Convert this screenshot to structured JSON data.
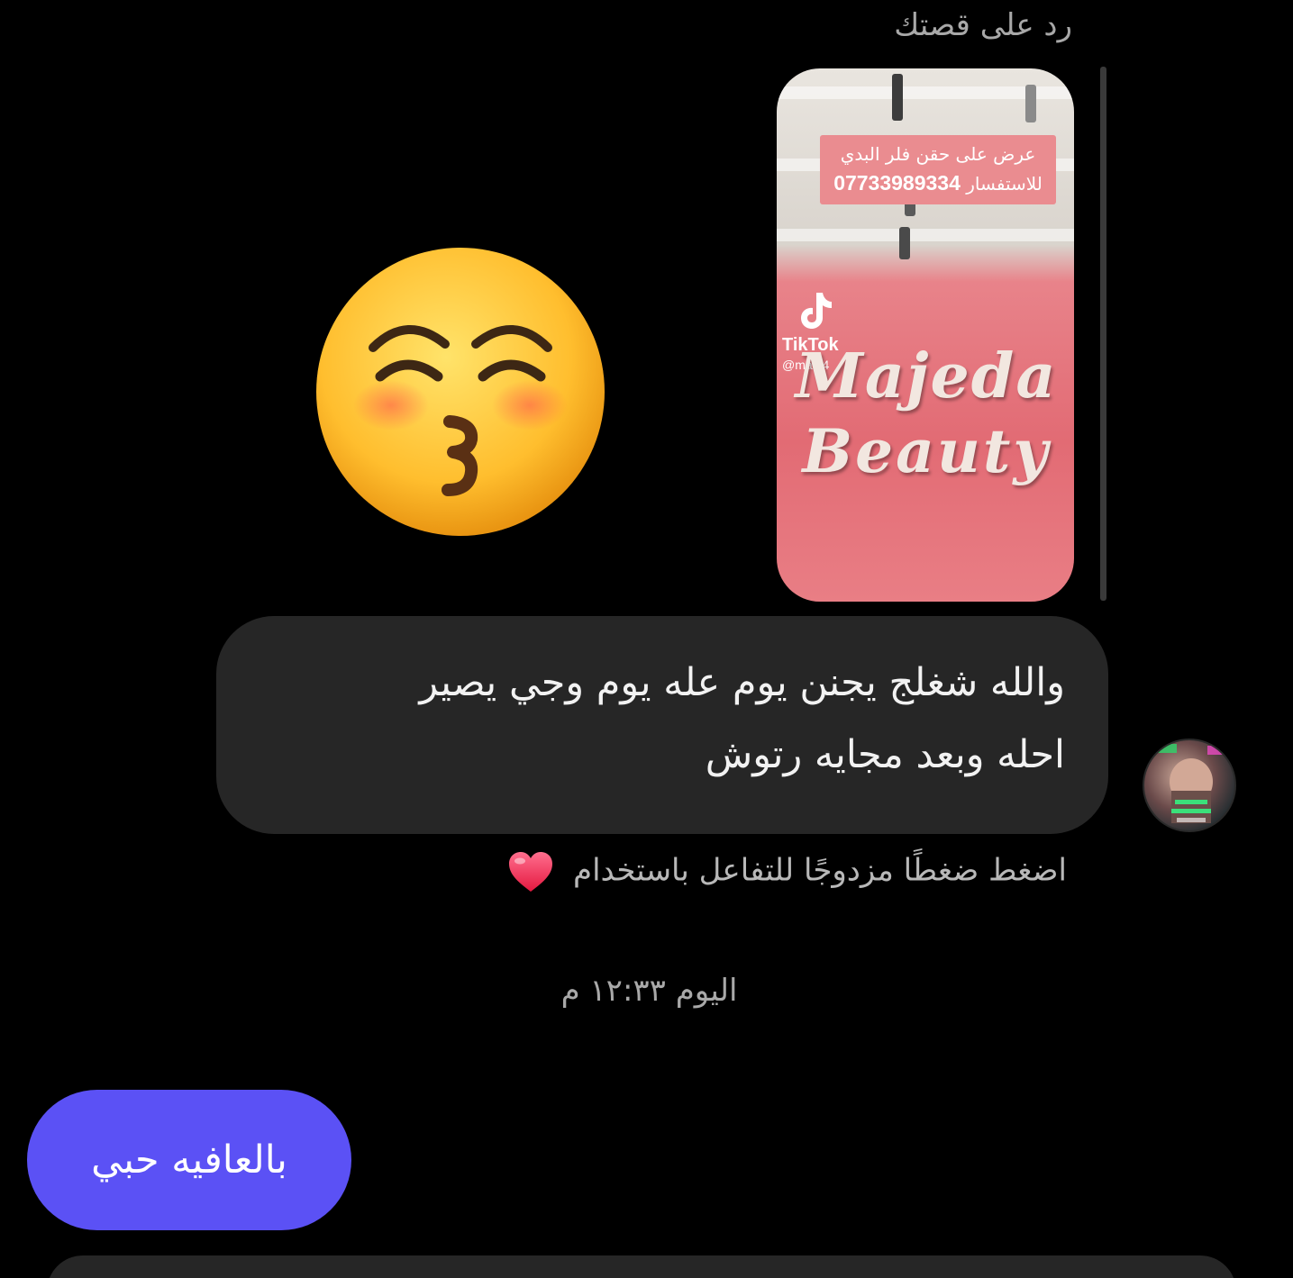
{
  "reply_header": "رد على قصتك",
  "story": {
    "caption_line1": "عرض على حقن فلر البدي",
    "caption_line2_label": "للاستفسار",
    "caption_phone": "07733989334",
    "tiktok_label": "TikTok",
    "tiktok_handle": "@ma8j4",
    "brand_line1": "Majeda",
    "brand_line2": "Beauty"
  },
  "reaction_emoji": "kissing-face-with-smiling-eyes",
  "incoming_message": {
    "line1": "والله شغلج يجنن يوم عله يوم وجي يصير",
    "line2": "احله وبعد مجايه رتوش"
  },
  "reaction_hint": "اضغط ضغطًا مزدوجًا للتفاعل باستخدام",
  "reaction_hint_icon": "heart-icon",
  "timestamp": "اليوم ١٢:٣٣ م",
  "outgoing_message": "بالعافيه حبي",
  "colors": {
    "background": "#000000",
    "incoming_bubble": "#262626",
    "outgoing_bubble": "#5b51f5",
    "muted_text": "#a8a8a8"
  }
}
